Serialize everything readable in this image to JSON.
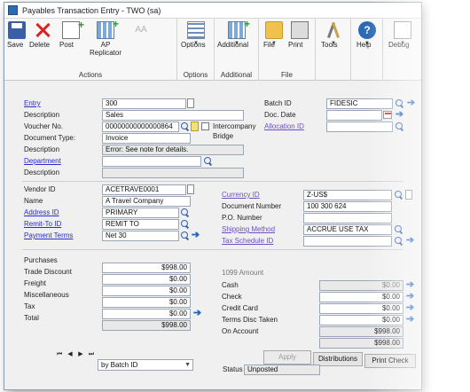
{
  "window": {
    "title": "Payables Transaction Entry  -  TWO (sa)"
  },
  "ribbon": {
    "actions": {
      "group_label": "Actions",
      "save": "Save",
      "delete": "Delete",
      "post": "Post",
      "ap_replicator": "AP Replicator",
      "aa": "AA"
    },
    "options": {
      "group_label": "Options",
      "options": "Options",
      "additional": "Additional"
    },
    "additional": {
      "group_label": "Additional"
    },
    "file": {
      "group_label": "File",
      "file": "File",
      "print": "Print"
    },
    "tools": "Tools",
    "help": "Help",
    "debug": "Debug"
  },
  "header": {
    "entry_label": "Entry",
    "entry_value": "300",
    "description_label": "Description",
    "description_value": "Sales",
    "voucher_label": "Voucher No.",
    "voucher_value": "00000000000000864",
    "intercompany_label": "Intercompany",
    "bridge_label": "Bridge",
    "doctype_label": "Document Type:",
    "doctype_value": "Invoice",
    "description2_label": "Description",
    "description2_value": "Error: See note for details.",
    "department_label": "Department",
    "description3_label": "Description",
    "batch_label": "Batch ID",
    "batch_value": "FIDESIC",
    "docdate_label": "Doc. Date",
    "allocation_label": "Allocation ID"
  },
  "vendor": {
    "vendor_label": "Vendor ID",
    "vendor_value": "ACETRAVE0001",
    "name_label": "Name",
    "name_value": "A Travel Company",
    "address_label": "Address ID",
    "address_value": "PRIMARY",
    "remit_label": "Remit-To ID",
    "remit_value": "REMIT TO",
    "terms_label": "Payment Terms",
    "terms_value": "Net 30",
    "currency_label": "Currency ID",
    "currency_value": "Z-US$",
    "docnum_label": "Document Number",
    "docnum_value": "100 300 624",
    "po_label": "P.O. Number",
    "shipping_label": "Shipping Method",
    "shipping_value": "ACCRUE USE TAX",
    "taxsched_label": "Tax Schedule ID"
  },
  "amounts": {
    "purchases_label": "Purchases",
    "purchases_value": "$998.00",
    "trade_discount_label": "Trade Discount",
    "trade_discount_value": "$0.00",
    "freight_label": "Freight",
    "freight_value": "$0.00",
    "misc_label": "Miscellaneous",
    "misc_value": "$0.00",
    "tax_label": "Tax",
    "tax_value": "$0.00",
    "total_label": "Total",
    "total_value": "$998.00",
    "amount_1099_label": "1099 Amount",
    "cash_label": "Cash",
    "cash_value": "$0.00",
    "check_label": "Check",
    "check_value": "$0.00",
    "credit_card_label": "Credit Card",
    "credit_card_value": "$0.00",
    "terms_disc_label": "Terms Disc Taken",
    "terms_disc_value": "$0.00",
    "on_account_label": "On Account",
    "on_account_value": "$998.00"
  },
  "footer": {
    "apply": "Apply",
    "distributions": "Distributions",
    "print_check": "Print Check",
    "sort_value": "by Batch ID",
    "status_label": "Status",
    "status_value": "Unposted"
  }
}
